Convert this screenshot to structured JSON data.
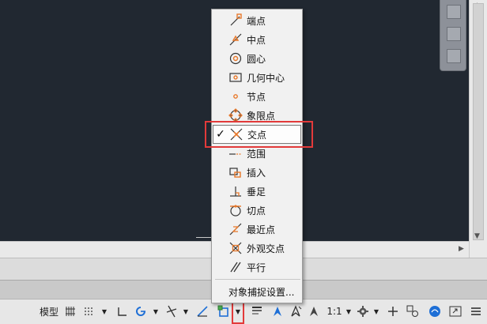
{
  "menu": {
    "items": [
      {
        "label": "端点",
        "icon": "endpoint-icon",
        "checked": false
      },
      {
        "label": "中点",
        "icon": "midpoint-icon",
        "checked": false
      },
      {
        "label": "圆心",
        "icon": "center-icon",
        "checked": false
      },
      {
        "label": "几何中心",
        "icon": "geometric-center-icon",
        "checked": false
      },
      {
        "label": "节点",
        "icon": "node-icon",
        "checked": false
      },
      {
        "label": "象限点",
        "icon": "quadrant-icon",
        "checked": false
      },
      {
        "label": "交点",
        "icon": "intersection-icon",
        "checked": true
      },
      {
        "label": "范围",
        "icon": "extension-icon",
        "checked": false
      },
      {
        "label": "插入",
        "icon": "insertion-icon",
        "checked": false
      },
      {
        "label": "垂足",
        "icon": "perpendicular-icon",
        "checked": false
      },
      {
        "label": "切点",
        "icon": "tangent-icon",
        "checked": false
      },
      {
        "label": "最近点",
        "icon": "nearest-icon",
        "checked": false
      },
      {
        "label": "外观交点",
        "icon": "apparent-intersection-icon",
        "checked": false
      },
      {
        "label": "平行",
        "icon": "parallel-icon",
        "checked": false
      }
    ],
    "check_mark": "✓",
    "settings_label": "对象捕捉设置..."
  },
  "status_bar": {
    "model_label": "模型",
    "scale_label": "1:1"
  },
  "colors": {
    "highlight": "#e23a3a",
    "icon_orange": "#e8782a",
    "accent_blue": "#1e6fd6"
  }
}
